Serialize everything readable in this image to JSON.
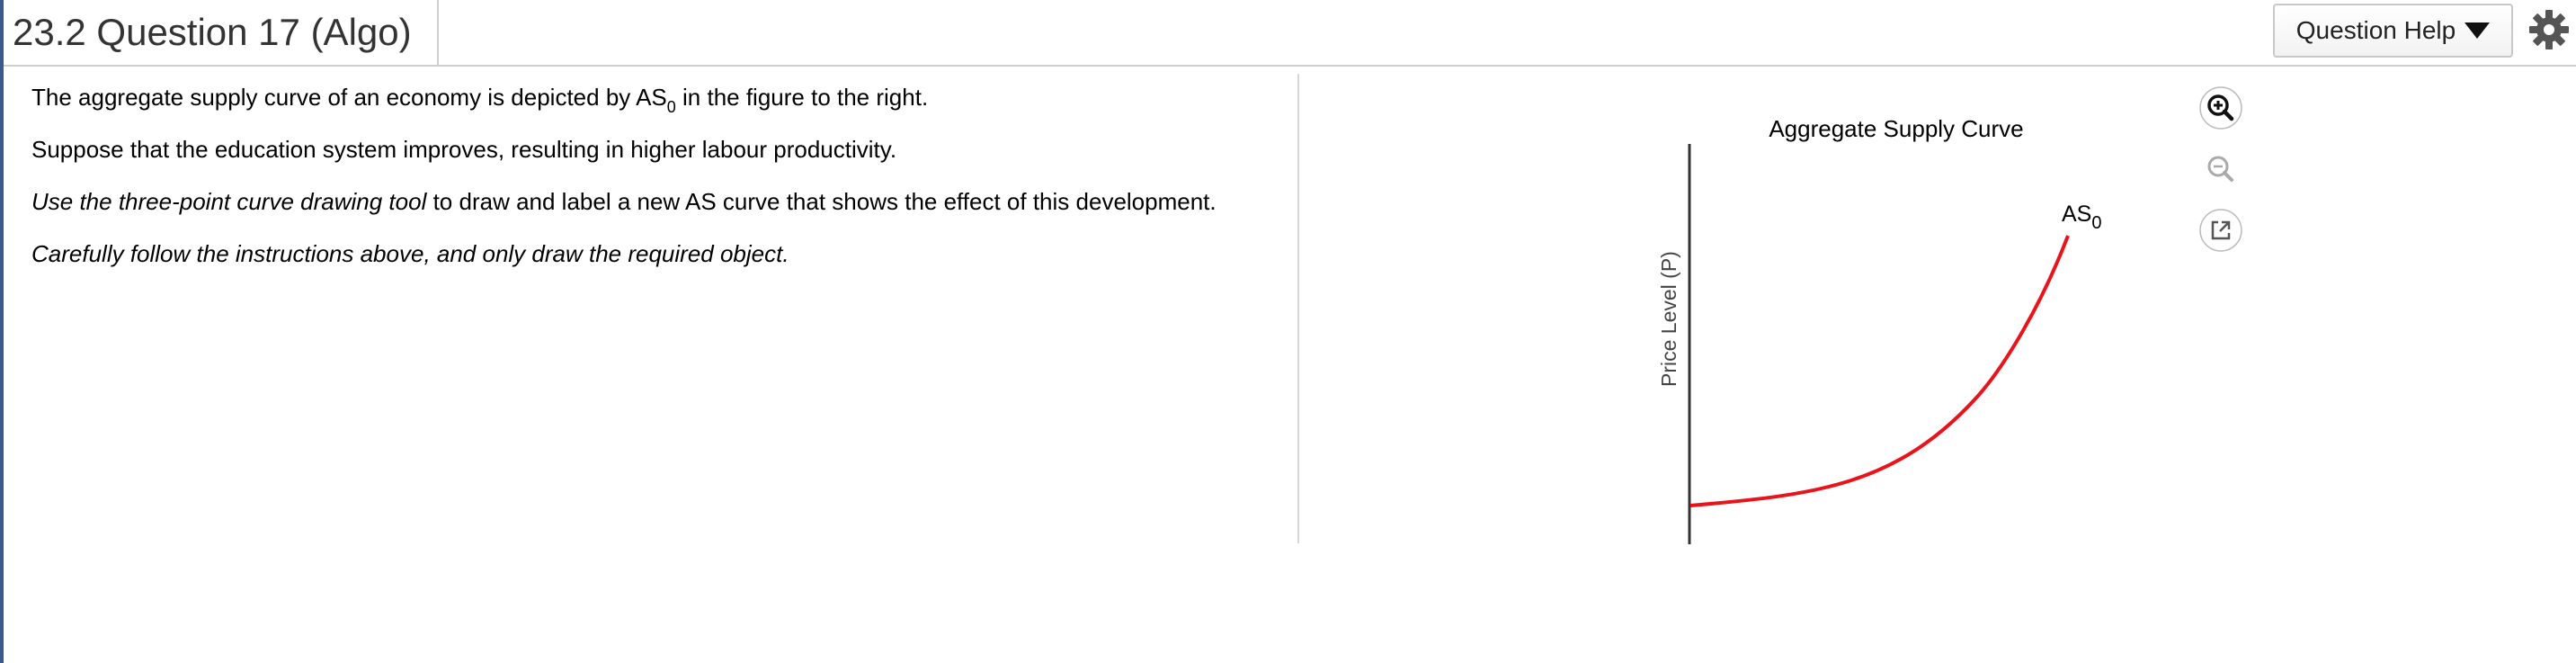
{
  "header": {
    "title": "23.2 Question 17 (Algo)",
    "help_button": "Question Help"
  },
  "question": {
    "line1_prefix": "The aggregate supply curve of an economy is depicted by AS",
    "line1_sub": "0",
    "line1_suffix": " in the figure to the right.",
    "line2": "Suppose that the education system improves, resulting in higher labour productivity.",
    "line3_italic": "Use the three-point curve drawing tool",
    "line3_rest": " to draw and label a new AS curve that shows the effect of this development.",
    "line4": "Carefully follow the instructions above, and only draw the required object."
  },
  "chart_data": {
    "type": "line",
    "title": "Aggregate Supply Curve",
    "ylabel": "Price Level (P)",
    "xlabel": "",
    "series": [
      {
        "name": "AS0",
        "label_main": "AS",
        "label_sub": "0",
        "color": "#e8141a"
      }
    ]
  },
  "tools": {
    "zoom_in": "zoom-in-icon",
    "zoom_out": "zoom-out-icon",
    "popout": "external-link-icon"
  },
  "colors": {
    "curve": "#e8141a",
    "left_edge": "#3b5a8c"
  }
}
